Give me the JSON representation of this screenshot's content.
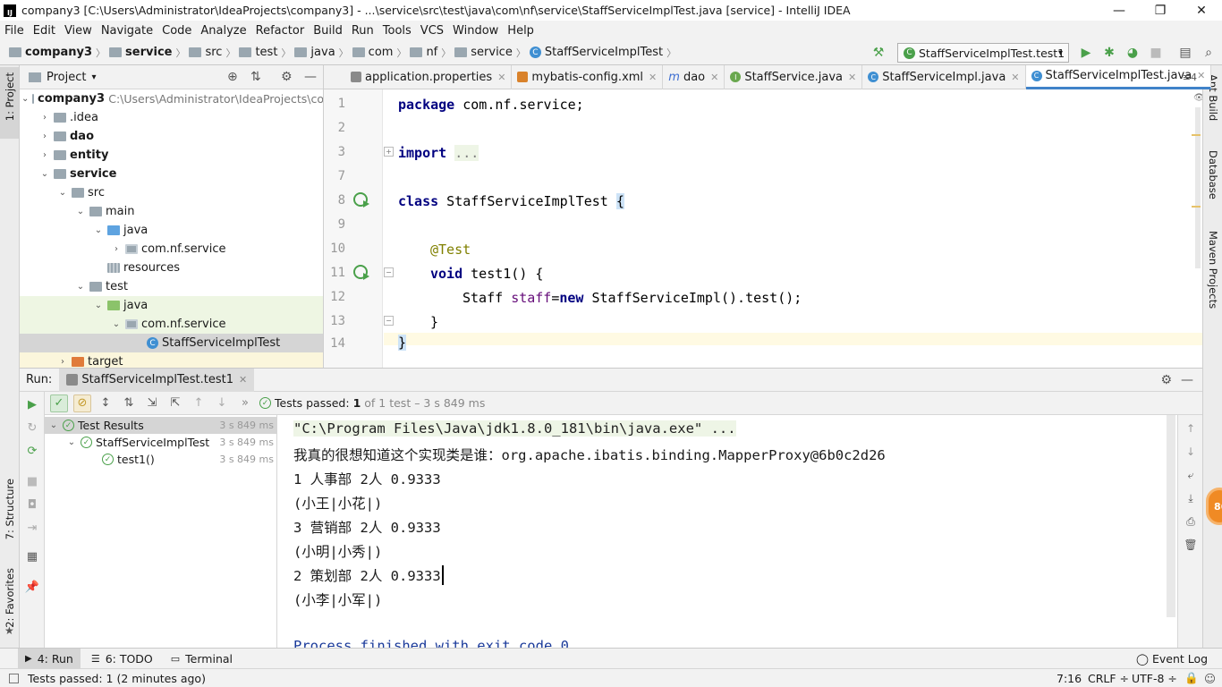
{
  "window": {
    "title": "company3 [C:\\Users\\Administrator\\IdeaProjects\\company3] - ...\\service\\src\\test\\java\\com\\nf\\service\\StaffServiceImplTest.java [service] - IntelliJ IDEA",
    "logo": "IJ",
    "minimize": "—",
    "maximize": "❐",
    "close": "✕"
  },
  "menu": [
    "File",
    "Edit",
    "View",
    "Navigate",
    "Code",
    "Analyze",
    "Refactor",
    "Build",
    "Run",
    "Tools",
    "VCS",
    "Window",
    "Help"
  ],
  "breadcrumb": [
    "company3",
    "service",
    "src",
    "test",
    "java",
    "com",
    "nf",
    "service",
    "StaffServiceImplTest"
  ],
  "toolbar": {
    "run_config": "StaffServiceImplTest.test1",
    "hammer_icon": "hammer-icon",
    "run_icon": "run-icon",
    "debug_icon": "debug-icon",
    "coverage_icon": "coverage-icon",
    "stop_icon": "stop-icon",
    "structure_icon": "project-structure-icon",
    "search_icon": "search-icon"
  },
  "left_strip": {
    "project": "1: Project",
    "structure": "7: Structure",
    "favorites": "2: Favorites"
  },
  "right_strip": {
    "ant": "Ant Build",
    "database": "Database",
    "maven": "Maven Projects"
  },
  "project_panel": {
    "title": "Project",
    "root_name": "company3",
    "root_path": "C:\\Users\\Administrator\\IdeaProjects\\co",
    "items": [
      {
        "label": "company3"
      },
      {
        "label": ".idea"
      },
      {
        "label": "dao"
      },
      {
        "label": "entity"
      },
      {
        "label": "service"
      },
      {
        "label": "src"
      },
      {
        "label": "main"
      },
      {
        "label": "java"
      },
      {
        "label": "com.nf.service"
      },
      {
        "label": "resources"
      },
      {
        "label": "test"
      },
      {
        "label": "java"
      },
      {
        "label": "com.nf.service"
      },
      {
        "label": "StaffServiceImplTest"
      },
      {
        "label": "target"
      }
    ]
  },
  "editor_tabs": [
    {
      "label": "application.properties"
    },
    {
      "label": "mybatis-config.xml"
    },
    {
      "label": "dao"
    },
    {
      "label": "StaffService.java"
    },
    {
      "label": "StaffServiceImpl.java"
    },
    {
      "label": "StaffServiceImplTest.java"
    }
  ],
  "editor_tabs_more": "≡4",
  "editor": {
    "line_numbers": [
      "1",
      "2",
      "3",
      "7",
      "8",
      "9",
      "10",
      "11",
      "12",
      "13",
      "14"
    ],
    "l1_kw": "package",
    "l1_rest": " com.nf.service;",
    "l3_kw": "import",
    "l3_dots": "...",
    "l8_kw": "class",
    "l8_rest": " StaffServiceImplTest ",
    "l8_brace": "{",
    "l10_ann": "@Test",
    "l11_kw": "void",
    "l11_rest": " test1() {",
    "l12_a": "Staff ",
    "l12_var": "staff",
    "l12_b": "=",
    "l12_kw": "new",
    "l12_c": " StaffServiceImpl().test();",
    "l13": "}",
    "l14": "}"
  },
  "run_panel": {
    "label": "Run:",
    "tab": "StaffServiceImplTest.test1",
    "status_prefix": "Tests passed:",
    "status_count": "1",
    "status_rest": "of 1 test – 3 s 849 ms",
    "tree": [
      {
        "label": "Test Results",
        "time": "3 s 849 ms"
      },
      {
        "label": "StaffServiceImplTest",
        "time": "3 s 849 ms"
      },
      {
        "label": "test1()",
        "time": "3 s 849 ms"
      }
    ],
    "console": [
      "\"C:\\Program Files\\Java\\jdk1.8.0_181\\bin\\java.exe\" ...",
      "我真的很想知道这个实现类是谁：org.apache.ibatis.binding.MapperProxy@6b0c2d26",
      "1 人事部 2人 0.9333",
      "(小王|小花|)",
      "3 营销部 2人 0.9333",
      "(小明|小秀|)",
      "2 策划部 2人 0.9333",
      "(小李|小军|)",
      "",
      "Process finished with exit code 0"
    ]
  },
  "bottom_tabs": [
    {
      "label": "4: Run"
    },
    {
      "label": "6: TODO"
    },
    {
      "label": "Terminal"
    }
  ],
  "event_log": "Event Log",
  "status": {
    "message": "Tests passed: 1 (2 minutes ago)",
    "position": "7:16",
    "line_sep": "CRLF ÷",
    "encoding": "UTF-8 ÷"
  },
  "badge": "86"
}
